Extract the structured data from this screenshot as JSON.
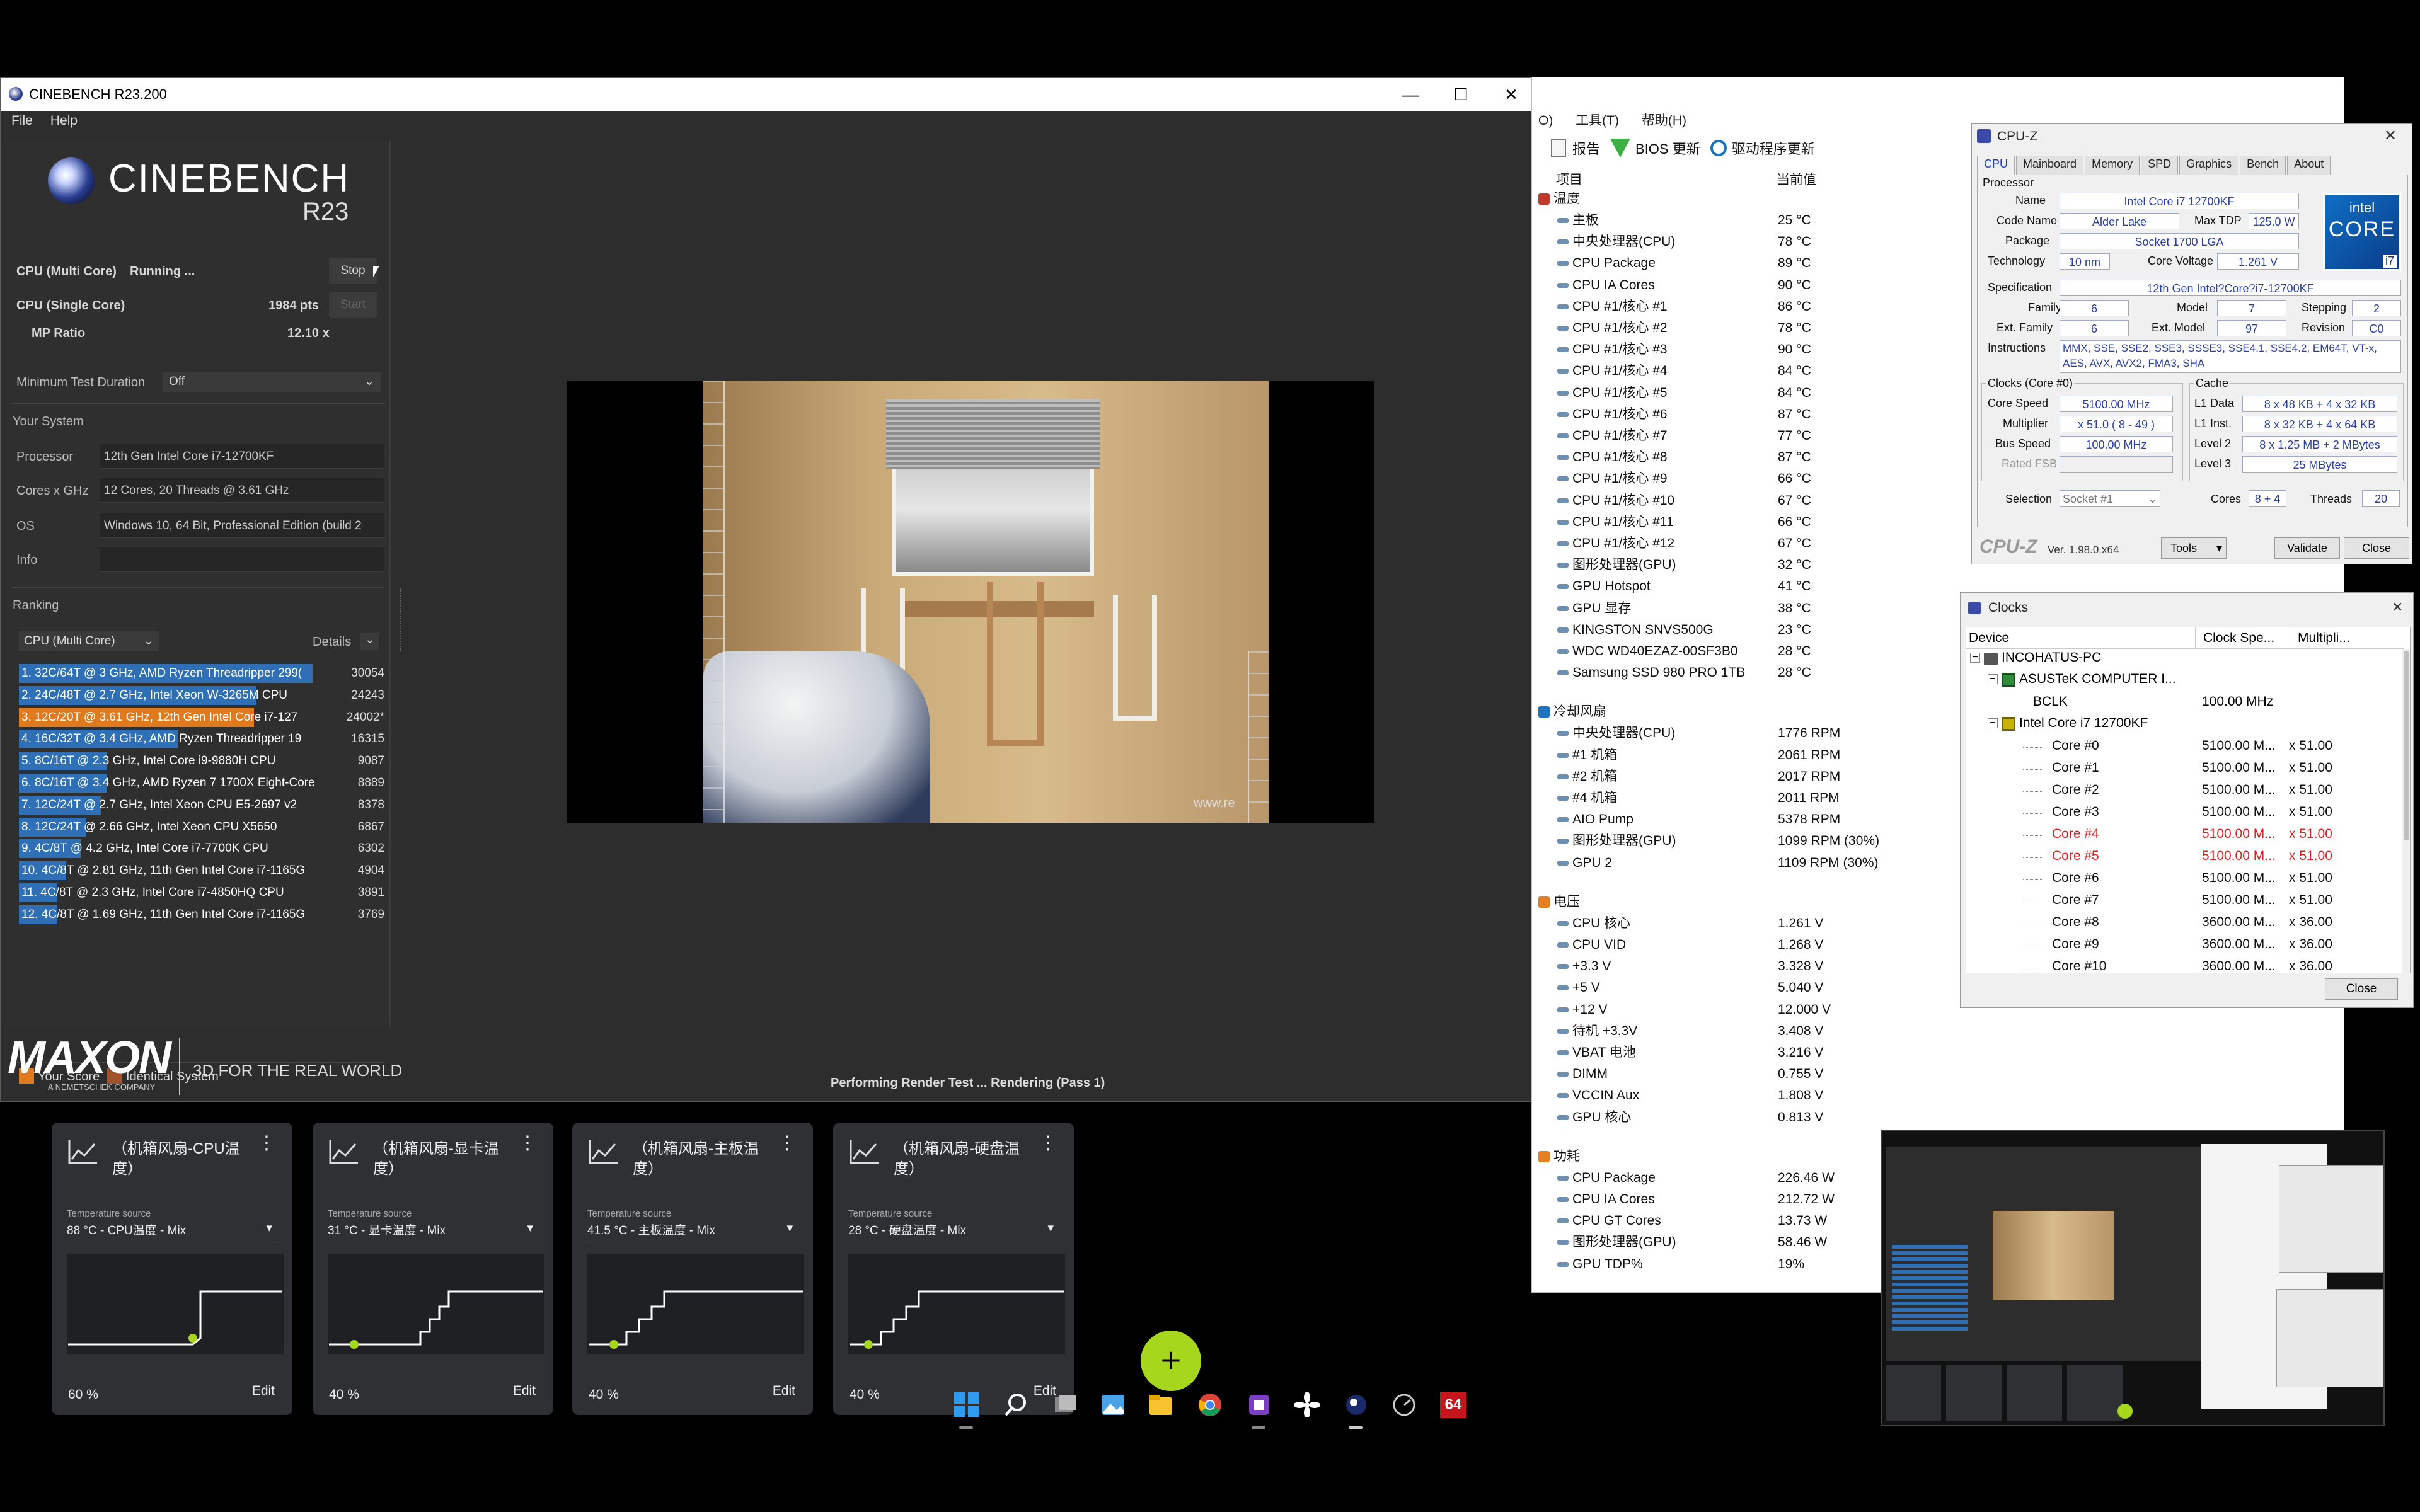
{
  "cinebench": {
    "window_title": "CINEBENCH R23.200",
    "menu": [
      "File",
      "Help"
    ],
    "logo": "CINEBENCH",
    "version": "R23",
    "multi_label": "CPU (Multi Core)",
    "multi_status": "Running ...",
    "stop": "Stop",
    "single_label": "CPU (Single Core)",
    "single_score": "1984 pts",
    "start": "Start",
    "mp_label": "MP Ratio",
    "mp_value": "12.10 x",
    "min_test_label": "Minimum Test Duration",
    "min_test_value": "Off",
    "your_system": "Your System",
    "system": [
      {
        "label": "Processor",
        "value": "12th Gen Intel Core i7-12700KF"
      },
      {
        "label": "Cores x GHz",
        "value": "12 Cores, 20 Threads @ 3.61 GHz"
      },
      {
        "label": "OS",
        "value": "Windows 10, 64 Bit, Professional Edition (build 2"
      },
      {
        "label": "Info",
        "value": ""
      }
    ],
    "ranking": "Ranking",
    "ranking_select": "CPU (Multi Core)",
    "details": "Details",
    "ranks": [
      {
        "text": "1. 32C/64T @ 3 GHz, AMD Ryzen Threadripper 299(",
        "score": "30054",
        "fill": 1.0,
        "color": "#2e6fb5"
      },
      {
        "text": "2. 24C/48T @ 2.7 GHz, Intel Xeon W-3265M CPU",
        "score": "24243",
        "fill": 0.81,
        "color": "#2e6fb5"
      },
      {
        "text": "3. 12C/20T @ 3.61 GHz, 12th Gen Intel Core i7-127",
        "score": "24002*",
        "fill": 0.8,
        "color": "#e07a1f"
      },
      {
        "text": "4. 16C/32T @ 3.4 GHz, AMD Ryzen Threadripper 19",
        "score": "16315",
        "fill": 0.54,
        "color": "#2e6fb5"
      },
      {
        "text": "5. 8C/16T @ 2.3 GHz, Intel Core i9-9880H CPU",
        "score": "9087",
        "fill": 0.3,
        "color": "#2e6fb5"
      },
      {
        "text": "6. 8C/16T @ 3.4 GHz, AMD Ryzen 7 1700X Eight-Core",
        "score": "8889",
        "fill": 0.3,
        "color": "#2e6fb5"
      },
      {
        "text": "7. 12C/24T @ 2.7 GHz, Intel Xeon CPU E5-2697 v2",
        "score": "8378",
        "fill": 0.28,
        "color": "#2e6fb5"
      },
      {
        "text": "8. 12C/24T @ 2.66 GHz, Intel Xeon CPU X5650",
        "score": "6867",
        "fill": 0.23,
        "color": "#2e6fb5"
      },
      {
        "text": "9. 4C/8T @ 4.2 GHz, Intel Core i7-7700K CPU",
        "score": "6302",
        "fill": 0.21,
        "color": "#2e6fb5"
      },
      {
        "text": "10. 4C/8T @ 2.81 GHz, 11th Gen Intel Core i7-1165G",
        "score": "4904",
        "fill": 0.16,
        "color": "#2e6fb5"
      },
      {
        "text": "11. 4C/8T @ 2.3 GHz, Intel Core i7-4850HQ CPU",
        "score": "3891",
        "fill": 0.13,
        "color": "#2e6fb5"
      },
      {
        "text": "12. 4C/8T @ 1.69 GHz, 11th Gen Intel Core i7-1165G",
        "score": "3769",
        "fill": 0.13,
        "color": "#2e6fb5"
      }
    ],
    "legend_your": "Your Score",
    "legend_identical": "Identical System",
    "maxon": "MAXON",
    "maxon_sub": "A NEMETSCHEK COMPANY",
    "tagline": "3D FOR THE REAL WORLD",
    "status": "Performing Render Test ... Rendering (Pass 1)",
    "watermark": "www.re"
  },
  "hwinfo": {
    "menu_tail": [
      "O)",
      "工具(T)",
      "帮助(H)"
    ],
    "toolbar": [
      "报告",
      "BIOS 更新",
      "驱动程序更新"
    ],
    "col_item": "项目",
    "col_value": "当前值",
    "sections": [
      {
        "title": "温度",
        "rows": [
          [
            "主板",
            "25 °C"
          ],
          [
            "中央处理器(CPU)",
            "78 °C"
          ],
          [
            "CPU Package",
            "89 °C"
          ],
          [
            "CPU IA Cores",
            "90 °C"
          ],
          [
            "CPU #1/核心 #1",
            "86 °C"
          ],
          [
            "CPU #1/核心 #2",
            "78 °C"
          ],
          [
            "CPU #1/核心 #3",
            "90 °C"
          ],
          [
            "CPU #1/核心 #4",
            "84 °C"
          ],
          [
            "CPU #1/核心 #5",
            "84 °C"
          ],
          [
            "CPU #1/核心 #6",
            "87 °C"
          ],
          [
            "CPU #1/核心 #7",
            "77 °C"
          ],
          [
            "CPU #1/核心 #8",
            "87 °C"
          ],
          [
            "CPU #1/核心 #9",
            "66 °C"
          ],
          [
            "CPU #1/核心 #10",
            "67 °C"
          ],
          [
            "CPU #1/核心 #11",
            "66 °C"
          ],
          [
            "CPU #1/核心 #12",
            "67 °C"
          ],
          [
            "图形处理器(GPU)",
            "32 °C"
          ],
          [
            "GPU Hotspot",
            "41 °C"
          ],
          [
            "GPU 显存",
            "38 °C"
          ],
          [
            "KINGSTON SNVS500G",
            "23 °C"
          ],
          [
            "WDC WD40EZAZ-00SF3B0",
            "28 °C"
          ],
          [
            "Samsung SSD 980 PRO 1TB",
            "28 °C"
          ]
        ]
      },
      {
        "title": "冷却风扇",
        "rows": [
          [
            "中央处理器(CPU)",
            "1776 RPM"
          ],
          [
            "#1 机箱",
            "2061 RPM"
          ],
          [
            "#2 机箱",
            "2017 RPM"
          ],
          [
            "#4 机箱",
            "2011 RPM"
          ],
          [
            "AIO Pump",
            "5378 RPM"
          ],
          [
            "图形处理器(GPU)",
            "1099 RPM  (30%)"
          ],
          [
            "GPU 2",
            "1109 RPM  (30%)"
          ]
        ]
      },
      {
        "title": "电压",
        "rows": [
          [
            "CPU 核心",
            "1.261 V"
          ],
          [
            "CPU VID",
            "1.268 V"
          ],
          [
            "+3.3 V",
            "3.328 V"
          ],
          [
            "+5 V",
            "5.040 V"
          ],
          [
            "+12 V",
            "12.000 V"
          ],
          [
            "待机 +3.3V",
            "3.408 V"
          ],
          [
            "VBAT 电池",
            "3.216 V"
          ],
          [
            "DIMM",
            "0.755 V"
          ],
          [
            "VCCIN Aux",
            "1.808 V"
          ],
          [
            "GPU 核心",
            "0.813 V"
          ]
        ]
      },
      {
        "title": "功耗",
        "rows": [
          [
            "CPU Package",
            "226.46 W"
          ],
          [
            "CPU IA Cores",
            "212.72 W"
          ],
          [
            "CPU GT Cores",
            "13.73 W"
          ],
          [
            "图形处理器(GPU)",
            "58.46 W"
          ],
          [
            "GPU TDP%",
            "19%"
          ]
        ]
      }
    ]
  },
  "cpuz": {
    "title": "CPU-Z",
    "tabs": [
      "CPU",
      "Mainboard",
      "Memory",
      "SPD",
      "Graphics",
      "Bench",
      "About"
    ],
    "processor_group": "Processor",
    "name_label": "Name",
    "name": "Intel Core i7 12700KF",
    "codename_label": "Code Name",
    "codename": "Alder Lake",
    "maxtdp_label": "Max TDP",
    "maxtdp": "125.0 W",
    "package_label": "Package",
    "package": "Socket 1700 LGA",
    "tech_label": "Technology",
    "tech": "10 nm",
    "voltage_label": "Core Voltage",
    "voltage": "1.261 V",
    "spec_label": "Specification",
    "spec": "12th Gen Intel?Core?i7-12700KF",
    "family_label": "Family",
    "family": "6",
    "model_label": "Model",
    "model": "7",
    "stepping_label": "Stepping",
    "stepping": "2",
    "extfamily_label": "Ext. Family",
    "extfamily": "6",
    "extmodel_label": "Ext. Model",
    "extmodel": "97",
    "revision_label": "Revision",
    "revision": "C0",
    "instr_label": "Instructions",
    "instr": "MMX, SSE, SSE2, SSE3, SSSE3, SSE4.1, SSE4.2, EM64T, VT-x, AES, AVX, AVX2, FMA3, SHA",
    "clocks_group": "Clocks (Core #0)",
    "corespeed_label": "Core Speed",
    "corespeed": "5100.00 MHz",
    "mult_label": "Multiplier",
    "mult": "x 51.0 ( 8 - 49 )",
    "bus_label": "Bus Speed",
    "bus": "100.00 MHz",
    "fsb_label": "Rated FSB",
    "cache_group": "Cache",
    "l1d_label": "L1 Data",
    "l1d": "8 x 48 KB + 4 x 32 KB",
    "l1i_label": "L1 Inst.",
    "l1i": "8 x 32 KB + 4 x 64 KB",
    "l2_label": "Level 2",
    "l2": "8 x 1.25 MB + 2 MBytes",
    "l3_label": "Level 3",
    "l3": "25 MBytes",
    "selection_label": "Selection",
    "selection": "Socket #1",
    "cores_label": "Cores",
    "cores": "8 + 4",
    "threads_label": "Threads",
    "threads": "20",
    "brand": "CPU-Z",
    "ver": "Ver. 1.98.0.x64",
    "tools": "Tools",
    "validate": "Validate",
    "close": "Close",
    "intel_badge": "intel",
    "core_badge": "CORE",
    "i7_badge": "i7"
  },
  "clocks": {
    "title": "Clocks",
    "cols": [
      "Device",
      "Clock Spe...",
      "Multipli..."
    ],
    "pc": "INCOHATUS-PC",
    "board": "ASUSTeK COMPUTER I...",
    "bclk_label": "BCLK",
    "bclk": "100.00 MHz",
    "cpu": "Intel Core i7 12700KF",
    "cores": [
      {
        "name": "Core #0",
        "clk": "5100.00 M...",
        "mult": "x 51.00",
        "hot": false
      },
      {
        "name": "Core #1",
        "clk": "5100.00 M...",
        "mult": "x 51.00",
        "hot": false
      },
      {
        "name": "Core #2",
        "clk": "5100.00 M...",
        "mult": "x 51.00",
        "hot": false
      },
      {
        "name": "Core #3",
        "clk": "5100.00 M...",
        "mult": "x 51.00",
        "hot": false
      },
      {
        "name": "Core #4",
        "clk": "5100.00 M...",
        "mult": "x 51.00",
        "hot": true
      },
      {
        "name": "Core #5",
        "clk": "5100.00 M...",
        "mult": "x 51.00",
        "hot": true
      },
      {
        "name": "Core #6",
        "clk": "5100.00 M...",
        "mult": "x 51.00",
        "hot": false
      },
      {
        "name": "Core #7",
        "clk": "5100.00 M...",
        "mult": "x 51.00",
        "hot": false
      },
      {
        "name": "Core #8",
        "clk": "3600.00 M...",
        "mult": "x 36.00",
        "hot": false
      },
      {
        "name": "Core #9",
        "clk": "3600.00 M...",
        "mult": "x 36.00",
        "hot": false
      },
      {
        "name": "Core #10",
        "clk": "3600.00 M...",
        "mult": "x 36.00",
        "hot": false
      }
    ],
    "close": "Close"
  },
  "fans": [
    {
      "title": "（机箱风扇-CPU温度）",
      "src_label": "Temperature source",
      "src": "88 °C - CPU温度 - Mix",
      "pct": "60 %",
      "edit": "Edit"
    },
    {
      "title": "（机箱风扇-显卡温度）",
      "src_label": "Temperature source",
      "src": "31 °C - 显卡温度 - Mix",
      "pct": "40 %",
      "edit": "Edit"
    },
    {
      "title": "（机箱风扇-主板温度）",
      "src_label": "Temperature source",
      "src": "41.5 °C - 主板温度 - Mix",
      "pct": "40 %",
      "edit": "Edit"
    },
    {
      "title": "（机箱风扇-硬盘温度）",
      "src_label": "Temperature source",
      "src": "28 °C - 硬盘温度 - Mix",
      "pct": "40 %",
      "edit": "Edit"
    }
  ],
  "fab_plus": "+",
  "taskbar_badge": "64",
  "colors": {
    "accent_green": "#a6d71c",
    "cinebench_blue": "#2e6fb5",
    "your_score": "#e07a1f",
    "identical": "#a0522d",
    "hot_core": "#e02020"
  }
}
